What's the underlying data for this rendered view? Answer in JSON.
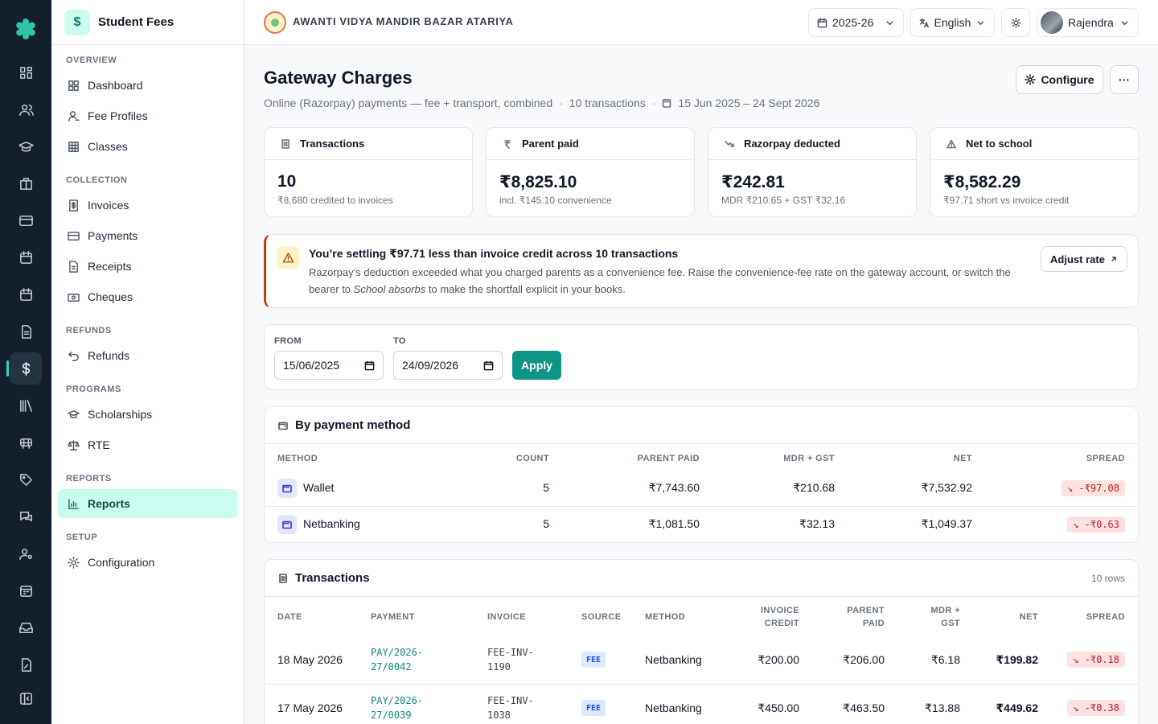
{
  "sidebar": {
    "title": "Student Fees",
    "sections": {
      "overview": "OVERVIEW",
      "collection": "COLLECTION",
      "refunds": "REFUNDS",
      "programs": "PROGRAMS",
      "reports": "REPORTS",
      "setup": "SETUP"
    },
    "items": {
      "dashboard": "Dashboard",
      "fee_profiles": "Fee Profiles",
      "classes": "Classes",
      "invoices": "Invoices",
      "payments": "Payments",
      "receipts": "Receipts",
      "cheques": "Cheques",
      "refunds": "Refunds",
      "scholarships": "Scholarships",
      "rte": "RTE",
      "reports": "Reports",
      "configuration": "Configuration"
    },
    "active_item": "Reports"
  },
  "topbar": {
    "school_name": "AWANTI VIDYA MANDIR BAZAR ATARIYA",
    "year": "2025-26",
    "language": "English",
    "user": "Rajendra"
  },
  "page": {
    "title": "Gateway Charges",
    "subtitle": "Online (Razorpay) payments — fee + transport, combined",
    "tx_count": "10 transactions",
    "date_range": "15 Jun 2025 – 24 Sept 2026",
    "configure_label": "Configure",
    "more_label": "···"
  },
  "stats": {
    "transactions": {
      "label": "Transactions",
      "value": "10",
      "note": "₹8,680 credited to invoices"
    },
    "parent_paid": {
      "label": "Parent paid",
      "value": "₹8,825.10",
      "note": "incl. ₹145.10 convenience"
    },
    "razorpay": {
      "label": "Razorpay deducted",
      "value": "₹242.81",
      "note": "MDR ₹210.65 + GST ₹32.16"
    },
    "net": {
      "label": "Net to school",
      "value": "₹8,582.29",
      "note": "₹97.71 short vs invoice credit"
    }
  },
  "alert": {
    "title": "You’re settling ₹97.71 less than invoice credit across 10 transactions",
    "body_1": "Razorpay’s deduction exceeded what you charged parents as a convenience fee. Raise the convenience-fee rate on the gateway account, or switch the bearer to ",
    "body_em": "School absorbs",
    "body_2": " to make the shortfall explicit in your books.",
    "action": "Adjust rate"
  },
  "filter": {
    "from_label": "FROM",
    "from_value": "15/06/2025",
    "to_label": "TO",
    "to_value": "24/09/2026",
    "apply": "Apply"
  },
  "by_method": {
    "title": "By payment method",
    "headers": {
      "method": "METHOD",
      "count": "COUNT",
      "parent_paid": "PARENT PAID",
      "mdr": "MDR + GST",
      "net": "NET",
      "spread": "SPREAD"
    },
    "rows": [
      {
        "method": "Wallet",
        "count": "5",
        "parent_paid": "₹7,743.60",
        "mdr": "₹210.68",
        "net": "₹7,532.92",
        "spread": "↘ -₹97.08"
      },
      {
        "method": "Netbanking",
        "count": "5",
        "parent_paid": "₹1,081.50",
        "mdr": "₹32.13",
        "net": "₹1,049.37",
        "spread": "↘ -₹0.63"
      }
    ]
  },
  "transactions": {
    "title": "Transactions",
    "row_count": "10 rows",
    "headers": {
      "date": "DATE",
      "payment": "PAYMENT",
      "invoice": "INVOICE",
      "source": "SOURCE",
      "method": "METHOD",
      "invoice_credit_1": "INVOICE",
      "invoice_credit_2": "CREDIT",
      "parent_paid_1": "PARENT",
      "parent_paid_2": "PAID",
      "mdr_1": "MDR +",
      "mdr_2": "GST",
      "net": "NET",
      "spread": "SPREAD"
    },
    "rows": [
      {
        "date": "18 May 2026",
        "payment_1": "PAY/2026-",
        "payment_2": "27/0042",
        "invoice_1": "FEE-INV-",
        "invoice_2": "1190",
        "source": "FEE",
        "method": "Netbanking",
        "invoice_credit": "₹200.00",
        "parent_paid": "₹206.00",
        "mdr": "₹6.18",
        "net": "₹199.82",
        "spread": "↘ -₹0.18"
      },
      {
        "date": "17 May 2026",
        "payment_1": "PAY/2026-",
        "payment_2": "27/0039",
        "invoice_1": "FEE-INV-",
        "invoice_2": "1038",
        "source": "FEE",
        "method": "Netbanking",
        "invoice_credit": "₹450.00",
        "parent_paid": "₹463.50",
        "mdr": "₹13.88",
        "net": "₹449.62",
        "spread": "↘ -₹0.38"
      }
    ]
  }
}
